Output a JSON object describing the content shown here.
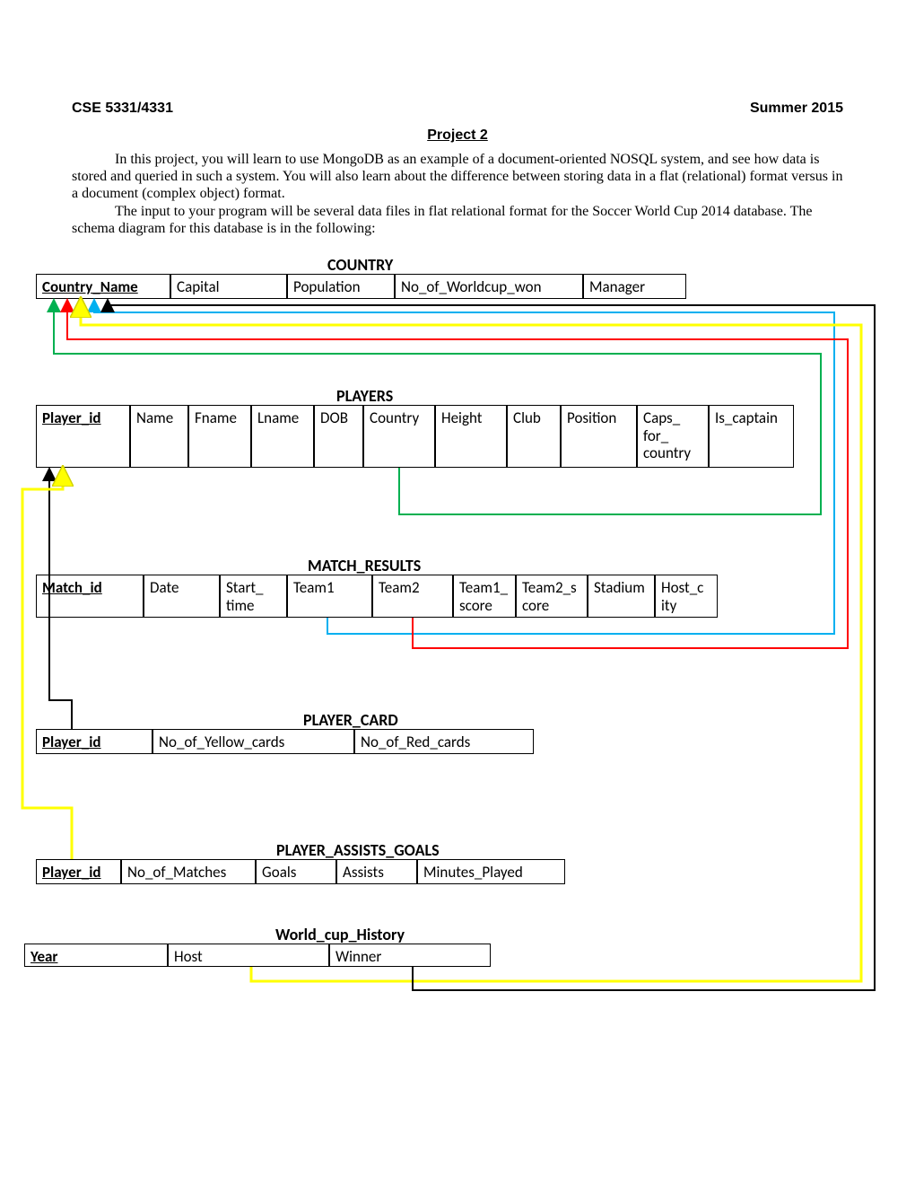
{
  "header": {
    "course": "CSE 5331/4331",
    "term": "Summer 2015",
    "project": "Project 2"
  },
  "intro": {
    "p1": "In this project, you will learn to use MongoDB as an example of a document-oriented NOSQL system, and see how data is stored and queried in such a system. You will also learn about the difference between storing data in a flat (relational) format versus in a document (complex object) format.",
    "p2": "The input to your program will be several data files in flat relational format for the Soccer World Cup 2014 database. The schema diagram for this database is in the following:"
  },
  "tables": {
    "country": {
      "title": "COUNTRY",
      "cols": {
        "c1": "Country_Name",
        "c2": "Capital",
        "c3": "Population",
        "c4": "No_of_Worldcup_won",
        "c5": "Manager"
      }
    },
    "players": {
      "title": "PLAYERS",
      "cols": {
        "c1": "Player_id",
        "c2": "Name",
        "c3": "Fname",
        "c4": "Lname",
        "c5": "DOB",
        "c6": "Country",
        "c7": "Height",
        "c8": "Club",
        "c9": "Position",
        "c10": "Caps_ for_ country",
        "c11": "Is_captain"
      }
    },
    "match_results": {
      "title": "MATCH_RESULTS",
      "cols": {
        "c1": "Match_id",
        "c2": "Date",
        "c3": "Start_ time",
        "c4": "Team1",
        "c5": "Team2",
        "c6": "Team1_ score",
        "c7": "Team2_s core",
        "c8": "Stadium",
        "c9": "Host_c ity"
      }
    },
    "player_card": {
      "title": "PLAYER_CARD",
      "cols": {
        "c1": "Player_id",
        "c2": "No_of_Yellow_cards",
        "c3": "No_of_Red_cards"
      }
    },
    "player_assists_goals": {
      "title": "PLAYER_ASSISTS_GOALS",
      "cols": {
        "c1": "Player_id",
        "c2": "No_of_Matches",
        "c3": "Goals",
        "c4": "Assists",
        "c5": "Minutes_Played"
      }
    },
    "world_cup_history": {
      "title": "World_cup_History",
      "cols": {
        "c1": "Year",
        "c2": "Host",
        "c3": "Winner"
      }
    }
  }
}
